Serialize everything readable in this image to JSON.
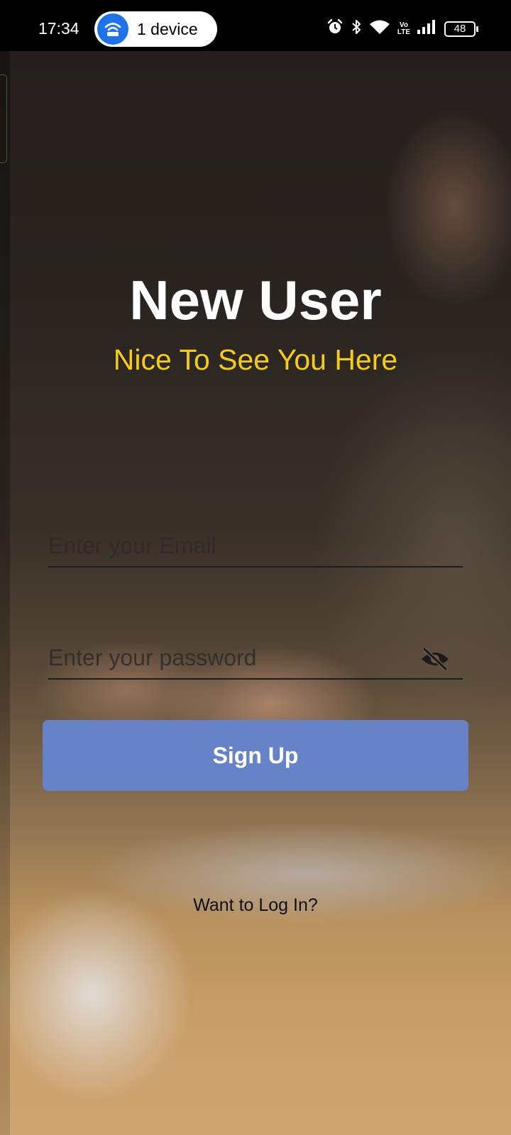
{
  "status_bar": {
    "time": "17:34",
    "hotspot_label": "1 device",
    "battery": "48",
    "volte_top": "Vo",
    "volte_bottom": "LTE",
    "icons": [
      "alarm-icon",
      "bluetooth-icon",
      "wifi-icon",
      "volte-icon",
      "signal-icon",
      "battery-icon"
    ]
  },
  "header": {
    "title": "New User",
    "subtitle": "Nice To See You Here"
  },
  "form": {
    "email_placeholder": "Enter your Email",
    "email_value": "",
    "password_placeholder": "Enter your password",
    "password_value": "",
    "signup_label": "Sign Up",
    "login_link": "Want to Log In?"
  },
  "colors": {
    "accent_yellow": "#f5cd16",
    "button_blue": "#6783c8",
    "hotspot_blue": "#1f73e8"
  }
}
